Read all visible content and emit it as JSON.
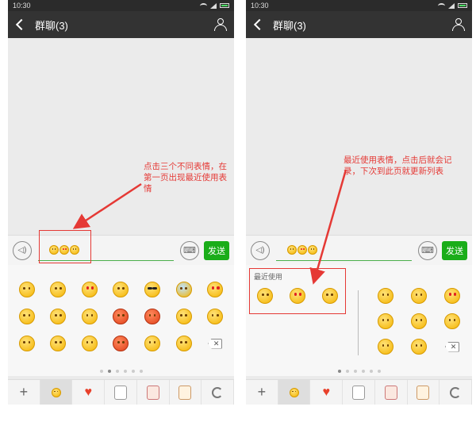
{
  "left_screen": {
    "status_time": "10:30",
    "title": "群聊(3)",
    "input_emojis": [
      "smile",
      "heart-eyes",
      "tongue"
    ],
    "send_label": "发送",
    "emoji_grid": [
      "smile",
      "shy",
      "heart-eyes",
      "shock",
      "cool",
      "cry",
      "heart-eyes",
      "laugh",
      "wink",
      "sleepy",
      "angry",
      "angry",
      "surprise",
      "grin",
      "think",
      "sad",
      "laugh",
      "angry",
      "shock",
      "think",
      "delete"
    ],
    "delete_glyph": "✕",
    "page_dots": 6,
    "active_dot": 1,
    "annotation": "点击三个不同表情，在第一页出现最近使用表情"
  },
  "right_screen": {
    "status_time": "10:30",
    "title": "群聊(3)",
    "input_emojis": [
      "smile",
      "heart-eyes",
      "tongue"
    ],
    "send_label": "发送",
    "recent_label": "最近使用",
    "recent_emojis": [
      "shock",
      "heart-eyes",
      "smile"
    ],
    "emoji_grid": [
      "smile",
      "shy",
      "heart-eyes",
      "laugh",
      "wink",
      "sleepy",
      "think",
      "sad",
      "delete"
    ],
    "delete_glyph": "✕",
    "page_dots": 6,
    "active_dot": 0,
    "annotation": "最近使用表情，点击后就会记录，下次到此页就更新列表"
  },
  "tab_bar": {
    "plus_glyph": "+",
    "heart_glyph": "♥",
    "active_tab": 1
  },
  "colors": {
    "annotation_red": "#e53935",
    "send_green": "#1aad19",
    "titlebar": "#333333"
  }
}
